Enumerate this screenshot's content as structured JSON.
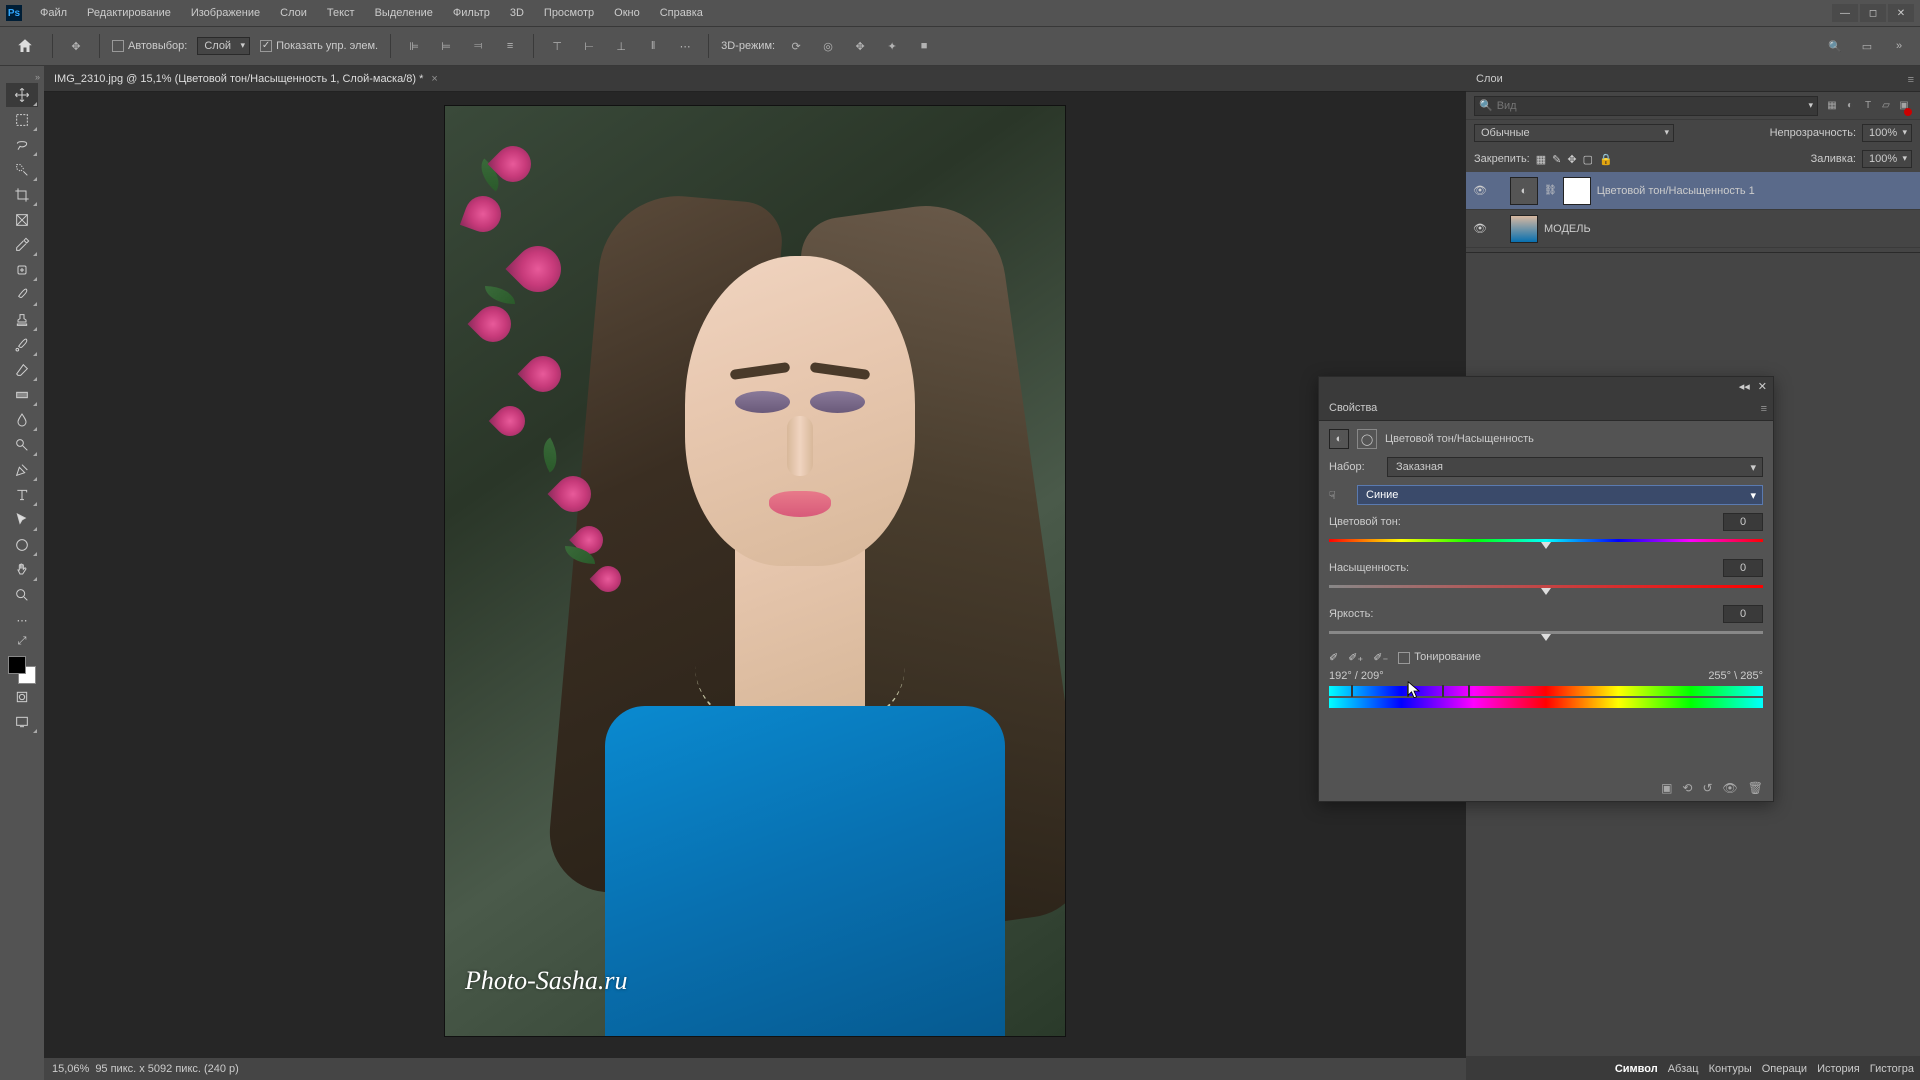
{
  "menu": {
    "items": [
      "Файл",
      "Редактирование",
      "Изображение",
      "Слои",
      "Текст",
      "Выделение",
      "Фильтр",
      "3D",
      "Просмотр",
      "Окно",
      "Справка"
    ]
  },
  "options": {
    "autoselect": "Автовыбор:",
    "autoselect_target": "Слой",
    "show_controls": "Показать упр. элем.",
    "mode3d": "3D-режим:"
  },
  "doc": {
    "tab": "IMG_2310.jpg @ 15,1% (Цветовой тон/Насыщенность 1, Слой-маска/8) *",
    "watermark": "Photo-Sasha.ru"
  },
  "status": {
    "zoom": "15,06%",
    "info": "95 пикс. x 5092 пикс. (240 p)"
  },
  "layers": {
    "title": "Слои",
    "search_ph": "Вид",
    "blend": "Обычные",
    "opacity_lbl": "Непрозрачность:",
    "opacity": "100%",
    "lock_lbl": "Закрепить:",
    "fill_lbl": "Заливка:",
    "fill": "100%",
    "items": [
      {
        "name": "Цветовой тон/Насыщенность 1",
        "sel": true,
        "type": "adj"
      },
      {
        "name": "МОДЕЛЬ",
        "sel": false,
        "type": "img"
      }
    ]
  },
  "props": {
    "title": "Свойства",
    "adj_name": "Цветовой тон/Насыщенность",
    "preset_lbl": "Набор:",
    "preset_val": "Заказная",
    "channel": "Синие",
    "hue_lbl": "Цветовой тон:",
    "hue_val": "0",
    "sat_lbl": "Насыщенность:",
    "sat_val": "0",
    "light_lbl": "Яркость:",
    "light_val": "0",
    "colorize": "Тонирование",
    "range_left": "192° / 209°",
    "range_right": "255° \\ 285°"
  },
  "tabs": {
    "b": [
      "Символ",
      "Абзац",
      "Контуры",
      "Операци",
      "История",
      "Гистогра"
    ]
  }
}
